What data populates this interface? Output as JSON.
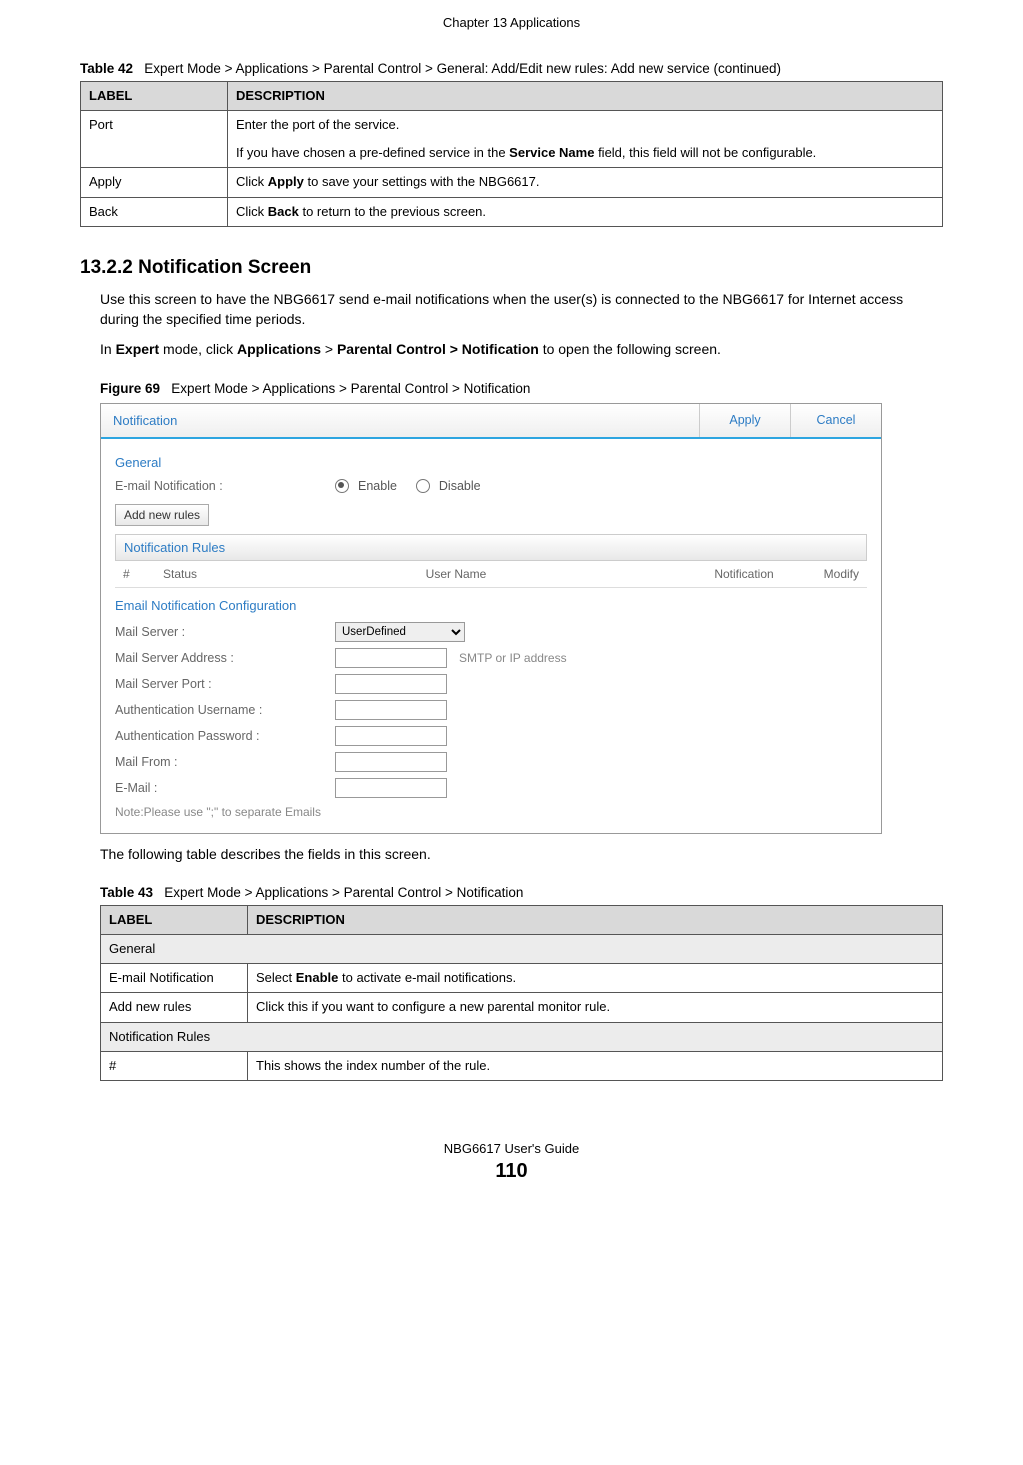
{
  "page": {
    "header": "Chapter 13 Applications",
    "footer_guide": "NBG6617 User's Guide",
    "footer_number": "110"
  },
  "table42": {
    "caption_prefix": "Table 42",
    "caption_rest": "Expert Mode > Applications > Parental Control > General: Add/Edit new rules: Add new service (continued)",
    "header_label": "LABEL",
    "header_desc": "DESCRIPTION",
    "rows": [
      {
        "label": "Port",
        "desc_plain_1": "Enter the port of the service.",
        "desc_rich_2_pre": "If you have chosen a pre-defined service in the ",
        "desc_rich_2_bold": "Service Name",
        "desc_rich_2_post": " field, this field will not be configurable."
      },
      {
        "label": "Apply",
        "desc_pre": "Click ",
        "desc_bold": "Apply",
        "desc_post": " to save your settings with the NBG6617."
      },
      {
        "label": "Back",
        "desc_pre": "Click ",
        "desc_bold": "Back",
        "desc_post": " to return to the previous screen."
      }
    ]
  },
  "section": {
    "number_title": "13.2.2  Notification Screen",
    "para1": "Use this screen to have the NBG6617 send e-mail notifications when the user(s) is connected to the NBG6617 for Internet access during the specified time periods.",
    "para2_pre": "In ",
    "para2_b1": "Expert",
    "para2_mid1": " mode, click ",
    "para2_b2": "Applications",
    "para2_mid2": " > ",
    "para2_b3": "Parental Control > Notification",
    "para2_post": " to open the following screen."
  },
  "figure69": {
    "caption_prefix": "Figure 69",
    "caption_rest": "Expert Mode > Applications > Parental Control > Notification",
    "header_title": "Notification",
    "btn_apply": "Apply",
    "btn_cancel": "Cancel",
    "general_title": "General",
    "email_notif_label": "E-mail Notification :",
    "enable": "Enable",
    "disable": "Disable",
    "add_rules_btn": "Add new rules",
    "rules_header": "Notification Rules",
    "col_hash": "#",
    "col_status": "Status",
    "col_username": "User Name",
    "col_notification": "Notification",
    "col_modify": "Modify",
    "email_conf_title": "Email Notification Configuration",
    "mail_server_label": "Mail Server :",
    "mail_server_value": "UserDefined",
    "mail_server_addr_label": "Mail Server Address :",
    "mail_server_addr_hint": "SMTP or IP address",
    "mail_server_port_label": "Mail Server Port :",
    "auth_user_label": "Authentication Username :",
    "auth_pass_label": "Authentication Password :",
    "mail_from_label": "Mail From :",
    "email_label": "E-Mail :",
    "note": "Note:Please use \";\" to separate Emails"
  },
  "after_figure_para": "The following table describes the fields in this screen.",
  "table43": {
    "caption_prefix": "Table 43",
    "caption_rest": "Expert Mode > Applications > Parental Control > Notification",
    "header_label": "LABEL",
    "header_desc": "DESCRIPTION",
    "rows": {
      "general": "General",
      "email_notif_label": "E-mail Notification",
      "email_notif_desc_pre": "Select ",
      "email_notif_desc_bold": "Enable",
      "email_notif_desc_post": " to activate e-mail notifications.",
      "add_rules_label": "Add new rules",
      "add_rules_desc": "Click this if you want to configure a new parental monitor rule.",
      "notif_rules": "Notification Rules",
      "hash_label": "#",
      "hash_desc": "This shows the index number of the rule."
    }
  }
}
